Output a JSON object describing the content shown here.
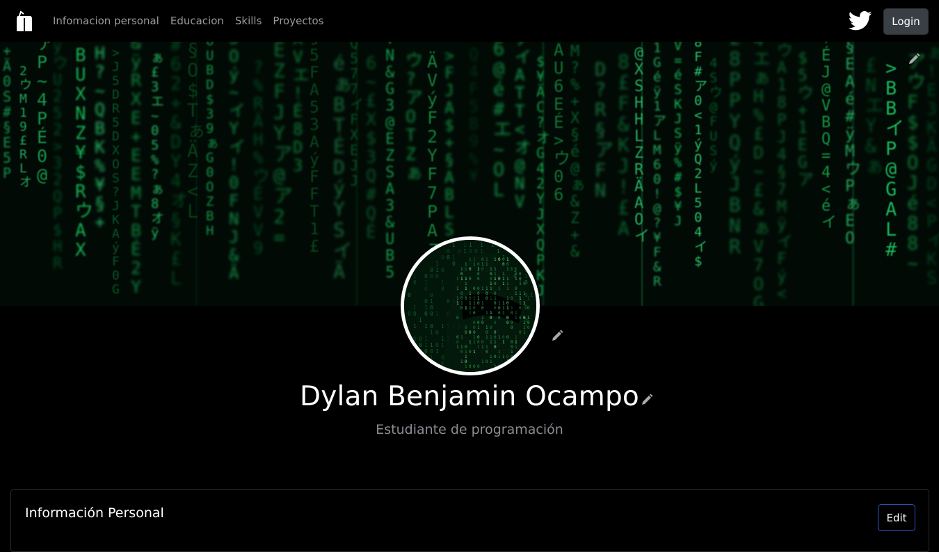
{
  "navbar": {
    "brand_icon": "ap-logo-icon",
    "links": [
      "Infomacion personal",
      "Educacion",
      "Skills",
      "Proyectos"
    ],
    "twitter_icon": "twitter-icon",
    "login_label": "Login"
  },
  "banner": {
    "edit_icon": "pencil-icon",
    "accent_color": "#1fd36a"
  },
  "profile": {
    "name": "Dylan Benjamin Ocampo",
    "subtitle": "Estudiante de programación",
    "edit_icon": "pencil-icon"
  },
  "card": {
    "title": "Información Personal",
    "edit_label": "Edit",
    "edit_border_color": "#2c56c4"
  }
}
